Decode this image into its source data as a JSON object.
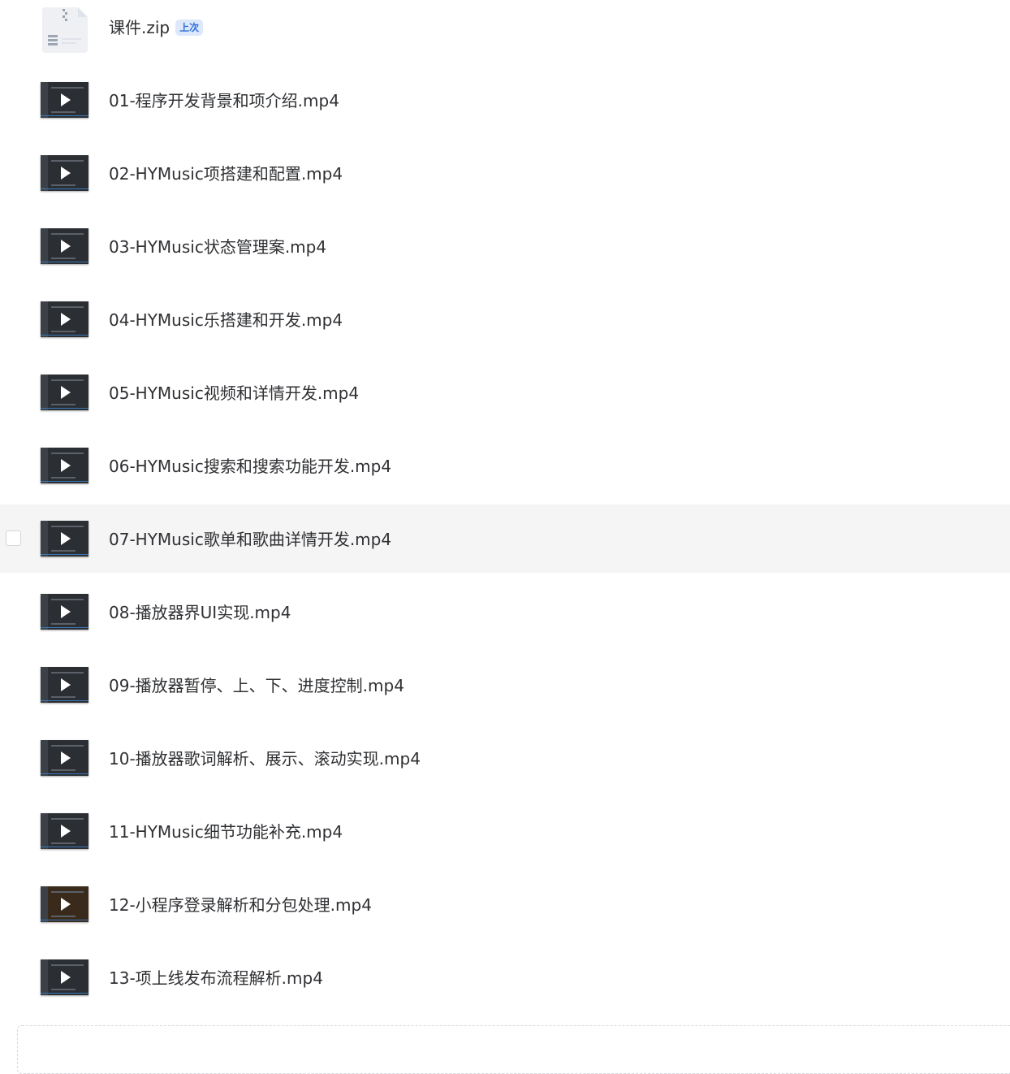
{
  "files": [
    {
      "name": "课件.zip",
      "type": "zip",
      "badge": "上次",
      "icon": "zip-file-icon"
    },
    {
      "name": "01-程序开发背景和项介绍.mp4",
      "type": "video",
      "icon": "play-icon"
    },
    {
      "name": "02-HYMusic项搭建和配置.mp4",
      "type": "video",
      "icon": "play-icon"
    },
    {
      "name": "03-HYMusic状态管理案.mp4",
      "type": "video",
      "icon": "play-icon"
    },
    {
      "name": "04-HYMusic乐搭建和开发.mp4",
      "type": "video",
      "icon": "play-icon"
    },
    {
      "name": "05-HYMusic视频和详情开发.mp4",
      "type": "video",
      "icon": "play-icon"
    },
    {
      "name": "06-HYMusic搜索和搜索功能开发.mp4",
      "type": "video",
      "icon": "play-icon"
    },
    {
      "name": "07-HYMusic歌单和歌曲详情开发.mp4",
      "type": "video",
      "icon": "play-icon",
      "hovered": true
    },
    {
      "name": "08-播放器界UI实现.mp4",
      "type": "video",
      "icon": "play-icon"
    },
    {
      "name": "09-播放器暂停、上、下、进度控制.mp4",
      "type": "video",
      "icon": "play-icon"
    },
    {
      "name": "10-播放器歌词解析、展示、滚动实现.mp4",
      "type": "video",
      "icon": "play-icon"
    },
    {
      "name": "11-HYMusic细节功能补充.mp4",
      "type": "video",
      "icon": "play-icon"
    },
    {
      "name": "12-小程序登录解析和分包处理.mp4",
      "type": "video",
      "icon": "play-icon"
    },
    {
      "name": "13-项上线发布流程解析.mp4",
      "type": "video",
      "icon": "play-icon"
    }
  ],
  "colors": {
    "text": "#2f3033",
    "badge_text": "#2f6fd6",
    "badge_bg": "#dde8fb",
    "hover_bg": "#f5f5f6",
    "thumb_bg": "#2b2e33"
  }
}
